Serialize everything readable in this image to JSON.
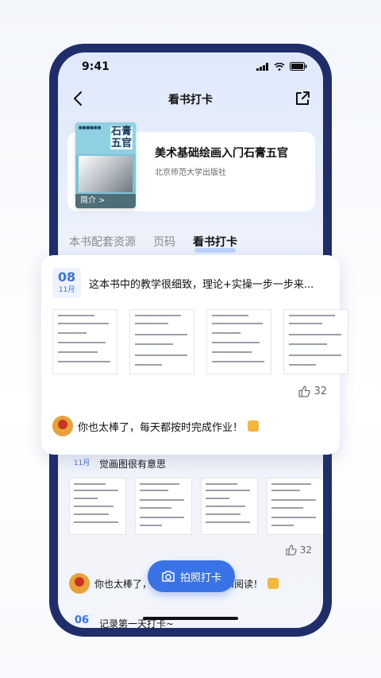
{
  "status_bar": {
    "time": "9:41"
  },
  "header": {
    "title": "看书打卡"
  },
  "book": {
    "title": "美术基础绘画入门石膏五官",
    "publisher": "北京师范大学出版社",
    "cover_title": "石膏五官",
    "cover_badge": "简介 >"
  },
  "tabs": [
    "本书配套资源",
    "页码",
    "看书打卡"
  ],
  "entries": [
    {
      "day": "08",
      "month": "11月",
      "text": "这本书中的教学很细致，理论+实操一步一步来...",
      "likes": "32",
      "comment": "你也太棒了，每天都按时完成作业！"
    },
    {
      "month": "11月",
      "text": "觉画图很有意思",
      "likes": "32",
      "comment": "你也太棒了，",
      "comment_tail": "和阅读！"
    },
    {
      "day": "06",
      "text": "记录第一天打卡~"
    }
  ],
  "fab": {
    "label": "拍照打卡"
  },
  "colors": {
    "accent": "#3a73e8",
    "frame": "#1f2d6b"
  },
  "icons": [
    "back-arrow-icon",
    "share-icon",
    "thumb-up-icon",
    "camera-icon",
    "signal-icon",
    "wifi-icon",
    "battery-icon"
  ]
}
